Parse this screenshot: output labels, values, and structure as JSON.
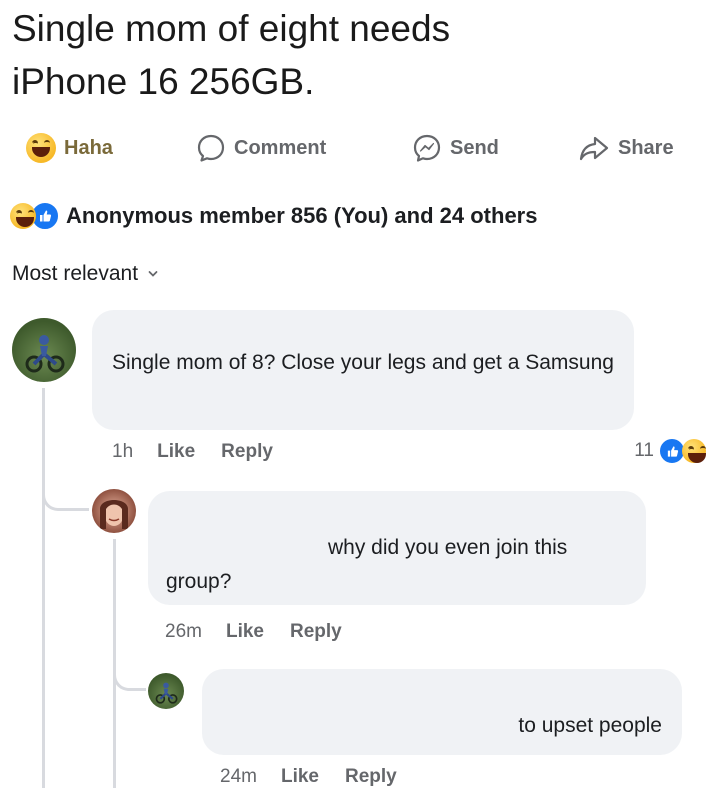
{
  "post": {
    "title_line1": "Single mom of eight needs",
    "title_line2": "iPhone 16 256GB."
  },
  "actions": {
    "haha": "Haha",
    "comment": "Comment",
    "send": "Send",
    "share": "Share"
  },
  "reactions": {
    "summary": "Anonymous member 856 (You) and 24 others"
  },
  "sort": {
    "label": "Most relevant"
  },
  "comments": [
    {
      "text": "Single mom of 8? Close your legs and get a Samsung",
      "time": "1h",
      "like": "Like",
      "reply": "Reply",
      "reaction_count": "11"
    },
    {
      "text_line1": "why did you even join this",
      "text_line2": "group?",
      "time": "26m",
      "like": "Like",
      "reply": "Reply"
    },
    {
      "text": "to upset people",
      "time": "24m",
      "like": "Like",
      "reply": "Reply"
    }
  ],
  "colors": {
    "accent": "#1877f2",
    "haha": "#f7b928",
    "bubble": "#f0f2f5",
    "muted": "#65676b"
  },
  "icons": [
    "haha-emoji-icon",
    "comment-icon",
    "send-icon",
    "share-icon",
    "like-reaction-icon",
    "chevron-down-icon"
  ]
}
